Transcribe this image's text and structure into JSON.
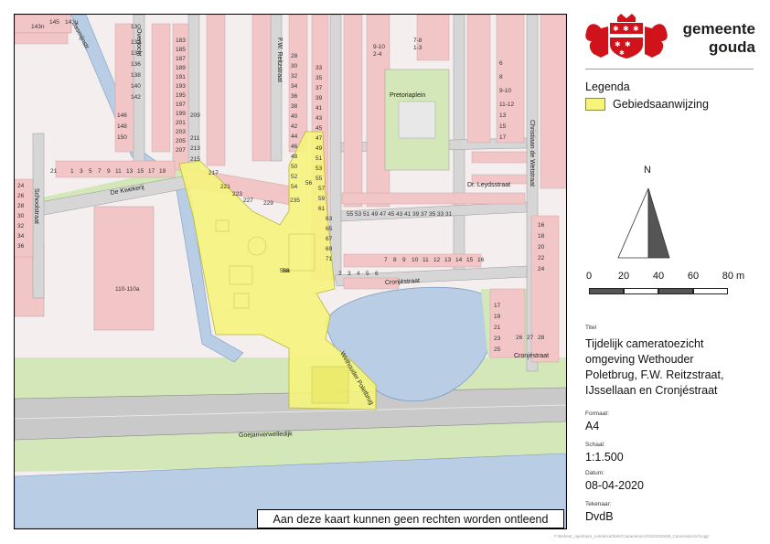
{
  "map": {
    "legend_color": "#f6f57a",
    "street_labels": {
      "kwekerij": "De Kwekerij",
      "schoolstraat": "Schoolstraat",
      "reitzstraat": "F.W. Reitzstraat",
      "jasmijn": "Jasmijnstr.",
      "overtocht": "Overtocht",
      "pretoriaplein": "Pretoriaplein",
      "leydsstraat": "Dr. Leydsstraat",
      "christiaan": "Christiaan de Wetstraat",
      "cronjestraat_1": "Cronjéstraat",
      "cronjestraat_2": "Cronjéstraat",
      "poletbrug": "Wethouder Poletbrug",
      "goejanverwelle": "Goejanverwelledijk"
    },
    "house_numbers": {
      "n143n": "143n",
      "n145": "145",
      "n143u": "143u",
      "n183": "183",
      "n185": "185",
      "n187": "187",
      "n189": "189",
      "n191": "191",
      "n193": "193",
      "n195": "195",
      "n197": "197",
      "n199": "199",
      "n201": "201",
      "n203": "203",
      "n205": "205",
      "n207": "207",
      "n209": "209",
      "n211": "211",
      "n213": "213",
      "n215": "215",
      "n217": "217",
      "n221": "221",
      "n223": "223",
      "n227": "227",
      "n229": "229",
      "n235": "235",
      "n130": "130",
      "n132": "132",
      "n134": "134",
      "n136": "136",
      "n138": "138",
      "n140": "140",
      "n142": "142",
      "n146": "146",
      "n148": "148",
      "n150": "150",
      "r_28": "28",
      "r_30": "30",
      "r_32": "32",
      "r_34": "34",
      "r_36": "36",
      "r_38": "38",
      "r_40": "40",
      "r_42": "42",
      "r_44": "44",
      "r_46": "46",
      "r_48": "48",
      "r_50": "50",
      "r_52": "52",
      "r_54": "54",
      "r_56": "56",
      "r_58": "58",
      "r_33": "33",
      "r_35": "35",
      "r_37": "37",
      "r_39": "39",
      "r_41": "41",
      "r_43": "43",
      "r_45": "45",
      "r_47": "47",
      "r_49": "49",
      "r_51": "51",
      "r_53": "53",
      "r_55": "55",
      "r_57": "57",
      "r_59": "59",
      "r_61": "61",
      "r_63": "63",
      "r_65": "65",
      "r_67": "67",
      "r_69": "69",
      "r_71": "71",
      "k_21": "21",
      "k_1": "1",
      "k_3": "3",
      "k_5": "5",
      "k_7": "7",
      "k_9": "9",
      "k_11": "11",
      "k_13": "13",
      "k_15": "15",
      "k_17": "17",
      "k_19": "19",
      "s_24": "24",
      "s_26": "26",
      "s_28": "28",
      "s_30": "30",
      "s_32": "32",
      "s_34": "34",
      "s_36": "36",
      "n110": "110-110a",
      "n58a": "58a",
      "n58": "58",
      "p_9_10": "9-10",
      "p_2_4": "2-4",
      "p_7_8": "7-8",
      "p_1_3": "1-3",
      "c_6": "6",
      "c_8": "8",
      "c_9_10": "9-10",
      "c_11_12": "11-12",
      "c_13": "13",
      "c_15": "15",
      "c_17": "17",
      "l_55": "55",
      "l_53": "53",
      "l_51": "51",
      "l_49": "49",
      "l_47": "47",
      "l_45": "45",
      "l_43": "43",
      "l_41": "41",
      "l_39": "39",
      "l_37": "37",
      "l_35": "35",
      "l_33": "33",
      "l_31": "31",
      "cr_2": "2",
      "cr_3": "3",
      "cr_4": "4",
      "cr_5": "5",
      "cr_6": "6",
      "cr_7": "7",
      "cr_8": "8",
      "cr_9": "9",
      "cr_10": "10",
      "cr_11": "11",
      "cr_12": "12",
      "cr_13": "13",
      "cr_14": "14",
      "cr_15": "15",
      "cr_16": "16",
      "e_16": "16",
      "e_17": "17",
      "e_18": "18",
      "e_19": "19",
      "e_20": "20",
      "e_21": "21",
      "e_22": "22",
      "e_23": "23",
      "e_24": "24",
      "e_25": "25",
      "e_26": "26",
      "e_27": "27",
      "e_28": "28"
    }
  },
  "disclaimer": "Aan deze kaart kunnen geen rechten worden ontleend",
  "logo": {
    "line1": "gemeente",
    "line2": "gouda",
    "red": "#d0121b"
  },
  "legend": {
    "title": "Legenda",
    "item": "Gebiedsaanwijzing"
  },
  "north_label": "N",
  "scale": {
    "ticks": [
      "0",
      "20",
      "40",
      "60",
      "80 m"
    ]
  },
  "meta": {
    "title_label": "Titel",
    "title_lines": [
      "Tijdelijk cameratoezicht",
      "omgeving Wethouder",
      "Poletbrug, F.W. Reitzstraat,",
      "IJssellaan en Cronjéstraat"
    ],
    "formaat_label": "Formaat:",
    "formaat": "A4",
    "schaal_label": "Schaal:",
    "schaal": "1:1.500",
    "datum_label": "Datum:",
    "datum": "08-04-2020",
    "tekenaar_label": "Tekenaar:",
    "tekenaar": "DvdB"
  },
  "filepath": "F:\\Beheer_openbare_ruimte\\cartheK\\Cameratoezicht\\20200408_Cameratoezicht.qgz"
}
